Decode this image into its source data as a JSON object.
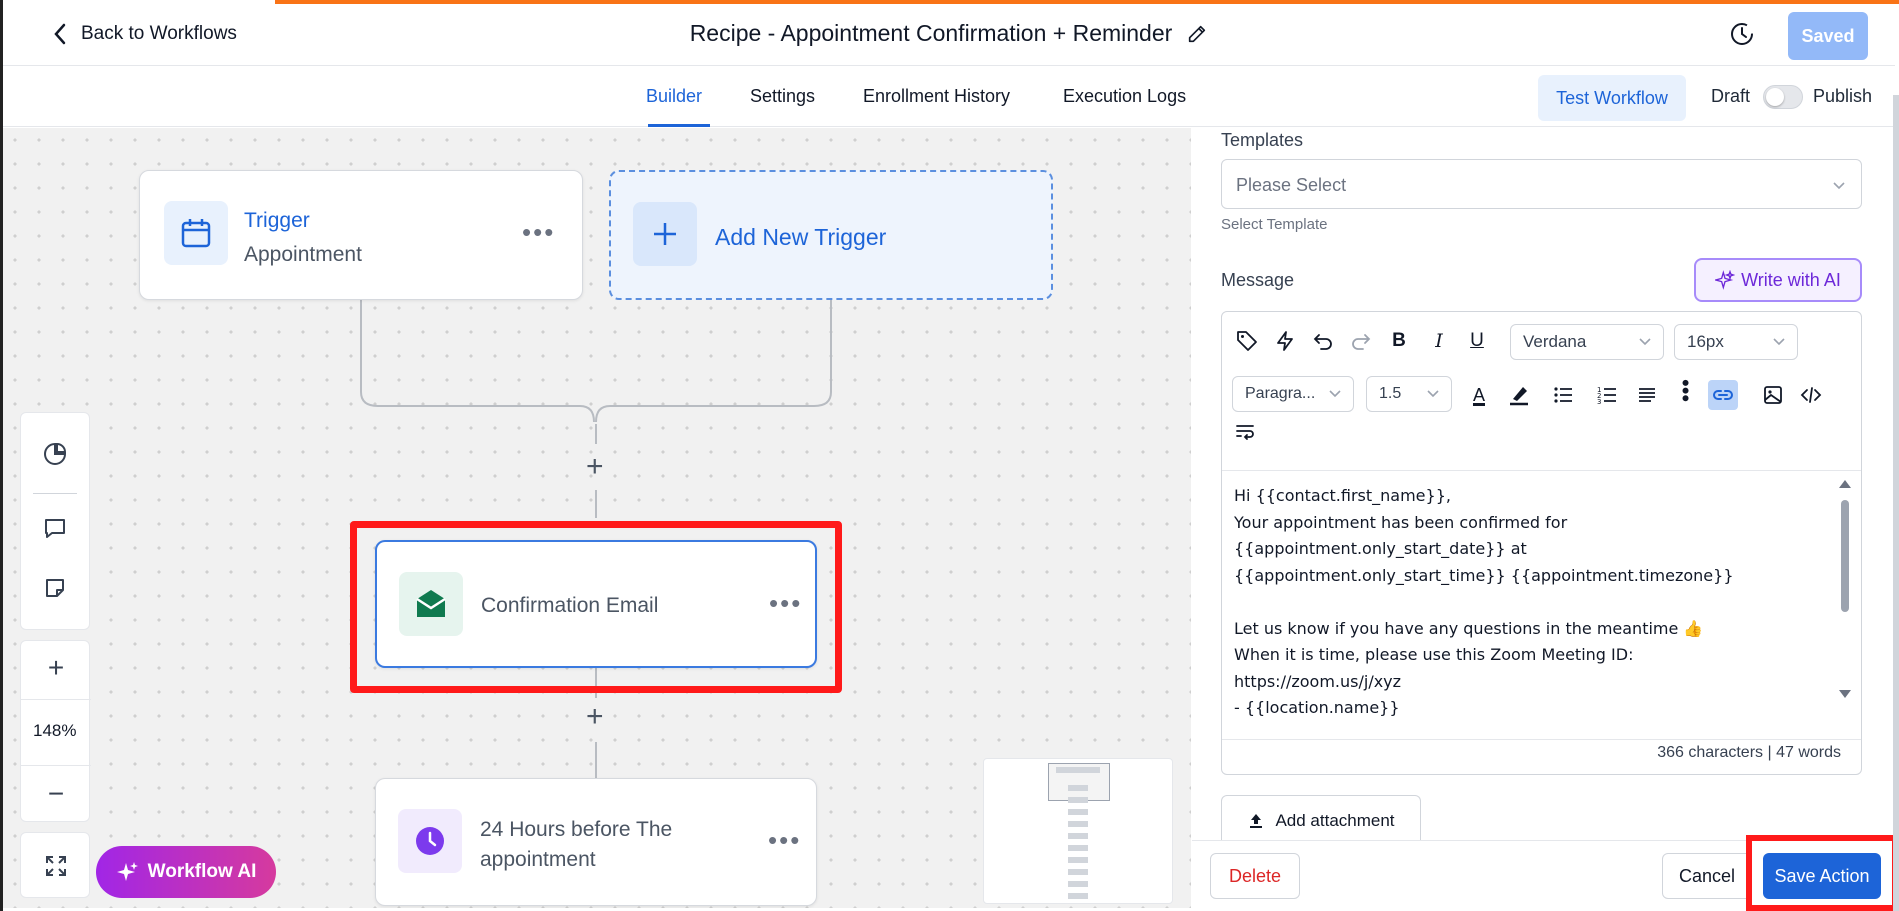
{
  "header": {
    "back_label": "Back to Workflows",
    "title": "Recipe - Appointment Confirmation + Reminder",
    "saved_label": "Saved"
  },
  "tabs": {
    "items": [
      {
        "label": "Builder",
        "active": true
      },
      {
        "label": "Settings"
      },
      {
        "label": "Enrollment History"
      },
      {
        "label": "Execution Logs"
      }
    ],
    "test_label": "Test Workflow",
    "draft_label": "Draft",
    "publish_label": "Publish"
  },
  "canvas": {
    "trigger": {
      "title": "Trigger",
      "subtitle": "Appointment"
    },
    "add_trigger_label": "Add New Trigger",
    "email_node_label": "Confirmation Email",
    "wait_node_label": "24 Hours before The appointment",
    "zoom_level": "148%",
    "workflow_ai_label": "Workflow AI"
  },
  "panel": {
    "templates_label": "Templates",
    "templates_placeholder": "Please Select",
    "templates_helper": "Select Template",
    "message_label": "Message",
    "write_ai_label": "Write with AI",
    "toolbar": {
      "font": "Verdana",
      "size": "16px",
      "block": "Paragra...",
      "line_height": "1.5"
    },
    "message_body": "Hi {{contact.first_name}},\nYour appointment has been confirmed for\n{{appointment.only_start_date}} at\n{{appointment.only_start_time}} {{appointment.timezone}}\n\nLet us know if you have any questions in the meantime 👍\nWhen it is time, please use this Zoom Meeting ID:\nhttps://zoom.us/j/xyz\n- {{location.name}}",
    "counter": "366 characters | 47 words",
    "attach_label": "Add attachment",
    "delete_label": "Delete",
    "cancel_label": "Cancel",
    "save_label": "Save Action"
  },
  "colors": {
    "accent": "#1d64d8",
    "highlight": "#ff1a1a",
    "frame": "#f97316",
    "email_icon": "#0f7a4f",
    "wait_icon": "#7c3aed"
  }
}
